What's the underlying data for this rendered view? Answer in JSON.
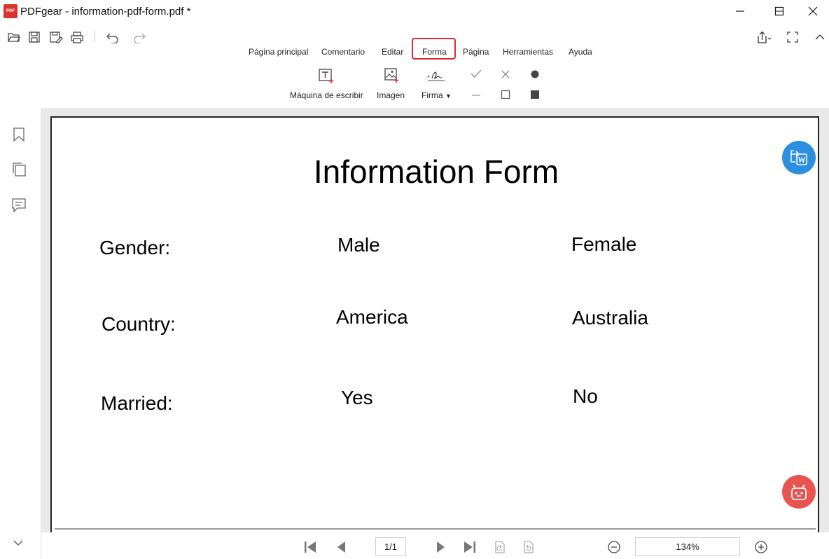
{
  "window": {
    "app_logo": "PDF",
    "title": "PDFgear - information-pdf-form.pdf *",
    "minimize_icon": "minimize-icon",
    "maximize_icon": "maximize-icon",
    "close_icon": "close-icon"
  },
  "quick_toolbar": {
    "icons": [
      "open-folder-icon",
      "save-icon",
      "save-as-icon",
      "print-icon",
      "undo-icon",
      "redo-icon",
      "share-icon",
      "fullscreen-icon",
      "collapse-ribbon-icon"
    ]
  },
  "ribbon": {
    "tabs": [
      "Página principal",
      "Comentario",
      "Editar",
      "Forma",
      "Página",
      "Herramientas",
      "Ayuda"
    ],
    "active_tab": "Forma",
    "tools": {
      "typewriter": "Máquina de escribir",
      "image": "Imagen",
      "signature": "Firma"
    },
    "form_marks": [
      "checkmark-icon",
      "cross-icon",
      "dot-icon",
      "line-icon",
      "empty-box-icon",
      "filled-box-icon"
    ]
  },
  "sidebar": {
    "icons": [
      "bookmark-icon",
      "pages-icon",
      "comment-icon",
      "chevron-down-icon"
    ]
  },
  "document": {
    "title": "Information Form",
    "rows": [
      {
        "label": "Gender:",
        "option1": "Male",
        "option2": "Female"
      },
      {
        "label": "Country:",
        "option1": "America",
        "option2": "Australia"
      },
      {
        "label": "Married:",
        "option1": "Yes",
        "option2": "No"
      }
    ]
  },
  "floating": {
    "convert_icon": "pdf-to-word-icon",
    "ai_icon": "ai-robot-icon",
    "convert_color": "#2d8fe0",
    "ai_color": "#e8544f"
  },
  "bottom_bar": {
    "page_indicator": "1/1",
    "zoom": "134%"
  },
  "colors": {
    "accent_red": "#e0282e",
    "brand_red": "#d9342b"
  }
}
